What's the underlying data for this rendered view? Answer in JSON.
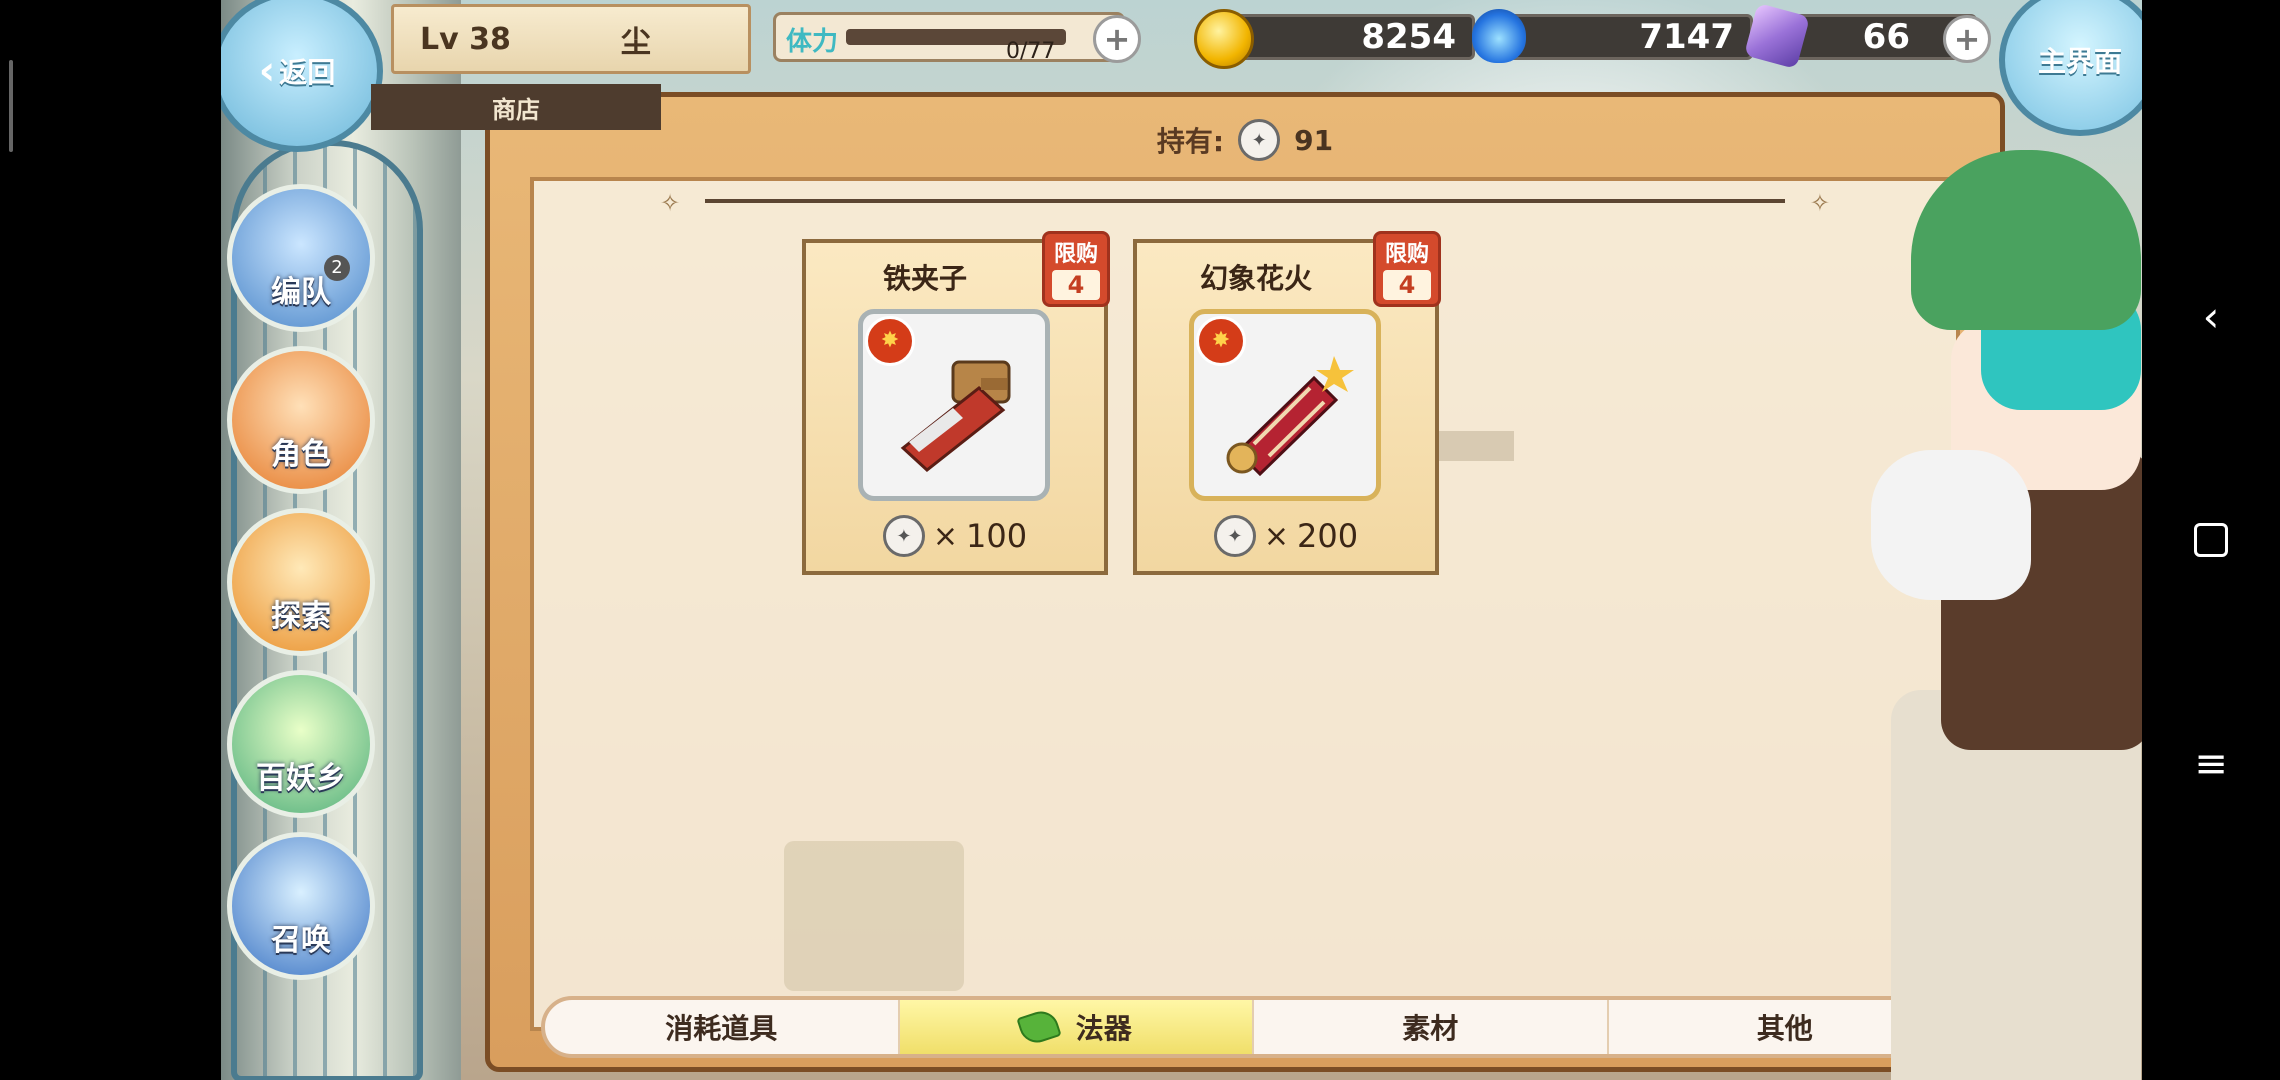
{
  "header": {
    "back_label": "返回",
    "level": "Lv 38",
    "player_name": "尘",
    "section": "商店",
    "home_label": "主界面"
  },
  "stamina": {
    "label": "体力",
    "value": "0/77"
  },
  "currencies": {
    "gold": "8254",
    "soul": "7147",
    "crystal": "66"
  },
  "side_menu": [
    {
      "label": "编队",
      "badge": "2"
    },
    {
      "label": "角色"
    },
    {
      "label": "探索"
    },
    {
      "label": "百妖乡"
    },
    {
      "label": "召唤"
    }
  ],
  "shop": {
    "owned_label": "持有:",
    "owned_value": "91",
    "items": [
      {
        "name": "铁夹子",
        "limit_label": "限购",
        "limit": "4",
        "price_prefix": "×",
        "price": "100"
      },
      {
        "name": "幻象花火",
        "limit_label": "限购",
        "limit": "4",
        "price_prefix": "×",
        "price": "200"
      }
    ]
  },
  "tabs": [
    {
      "label": "消耗道具",
      "active": false
    },
    {
      "label": "法器",
      "active": true
    },
    {
      "label": "素材",
      "active": false
    },
    {
      "label": "其他",
      "active": false
    }
  ],
  "colors": {
    "accent_active_tab": "#f0df6a",
    "limit_badge": "#d44a2c",
    "panel_frame": "#d99e5d"
  },
  "icons": [
    "back-chevron-icon",
    "plus-icon",
    "gold-coin-icon",
    "blue-soul-icon",
    "crystal-icon",
    "shop-token-icon",
    "leaf-icon"
  ]
}
